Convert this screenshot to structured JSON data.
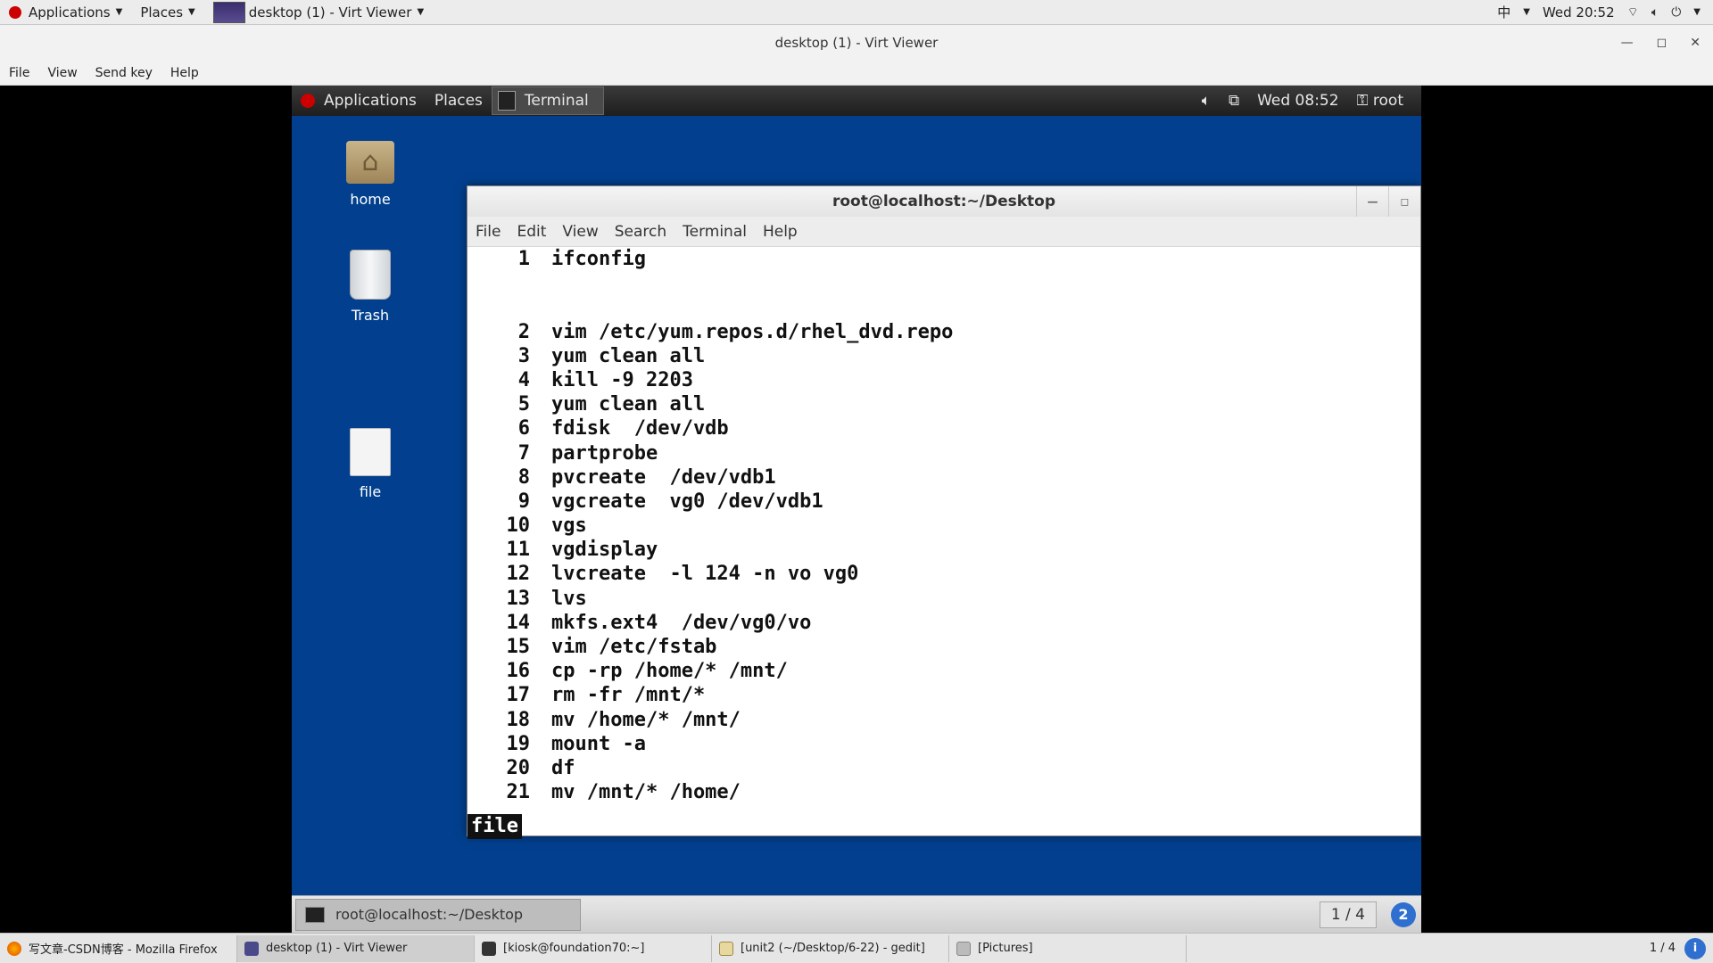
{
  "host_panel": {
    "applications": "Applications",
    "places": "Places",
    "window_task": "desktop (1) - Virt Viewer",
    "input_method": "中",
    "clock": "Wed 20:52"
  },
  "viewer": {
    "title": "desktop (1) - Virt Viewer",
    "menu": [
      "File",
      "View",
      "Send key",
      "Help"
    ]
  },
  "guest_panel": {
    "applications": "Applications",
    "places": "Places",
    "terminal_tab": "Terminal",
    "clock": "Wed 08:52",
    "user": "root"
  },
  "desktop_icons": {
    "home": "home",
    "trash": "Trash",
    "file": "file"
  },
  "terminal": {
    "title": "root@localhost:~/Desktop",
    "menu": [
      "File",
      "Edit",
      "View",
      "Search",
      "Terminal",
      "Help"
    ],
    "history": [
      {
        "n": "1",
        "cmd": "ifconfig"
      },
      {
        "n": "",
        "cmd": ""
      },
      {
        "n": "",
        "cmd": ""
      },
      {
        "n": "2",
        "cmd": "vim /etc/yum.repos.d/rhel_dvd.repo"
      },
      {
        "n": "3",
        "cmd": "yum clean all"
      },
      {
        "n": "4",
        "cmd": "kill -9 2203"
      },
      {
        "n": "5",
        "cmd": "yum clean all"
      },
      {
        "n": "6",
        "cmd": "fdisk  /dev/vdb"
      },
      {
        "n": "7",
        "cmd": "partprobe"
      },
      {
        "n": "8",
        "cmd": "pvcreate  /dev/vdb1"
      },
      {
        "n": "9",
        "cmd": "vgcreate  vg0 /dev/vdb1"
      },
      {
        "n": "10",
        "cmd": "vgs"
      },
      {
        "n": "11",
        "cmd": "vgdisplay"
      },
      {
        "n": "12",
        "cmd": "lvcreate  -l 124 -n vo vg0"
      },
      {
        "n": "13",
        "cmd": "lvs"
      },
      {
        "n": "14",
        "cmd": "mkfs.ext4  /dev/vg0/vo"
      },
      {
        "n": "15",
        "cmd": "vim /etc/fstab"
      },
      {
        "n": "16",
        "cmd": "cp -rp /home/* /mnt/"
      },
      {
        "n": "17",
        "cmd": "rm -fr /mnt/*"
      },
      {
        "n": "18",
        "cmd": "mv /home/* /mnt/"
      },
      {
        "n": "19",
        "cmd": "mount -a"
      },
      {
        "n": "20",
        "cmd": "df"
      },
      {
        "n": "21",
        "cmd": "mv /mnt/* /home/"
      }
    ],
    "status": "file"
  },
  "guest_bottom": {
    "task": "root@localhost:~/Desktop",
    "workspace": "1 / 4",
    "help": "2"
  },
  "host_taskbar": {
    "tasks": [
      "写文章-CSDN博客 - Mozilla Firefox",
      "desktop (1) - Virt Viewer",
      "[kiosk@foundation70:~]",
      "[unit2 (~/Desktop/6-22) - gedit]",
      "[Pictures]"
    ],
    "workspace": "1 / 4",
    "ws_badge": "i"
  }
}
